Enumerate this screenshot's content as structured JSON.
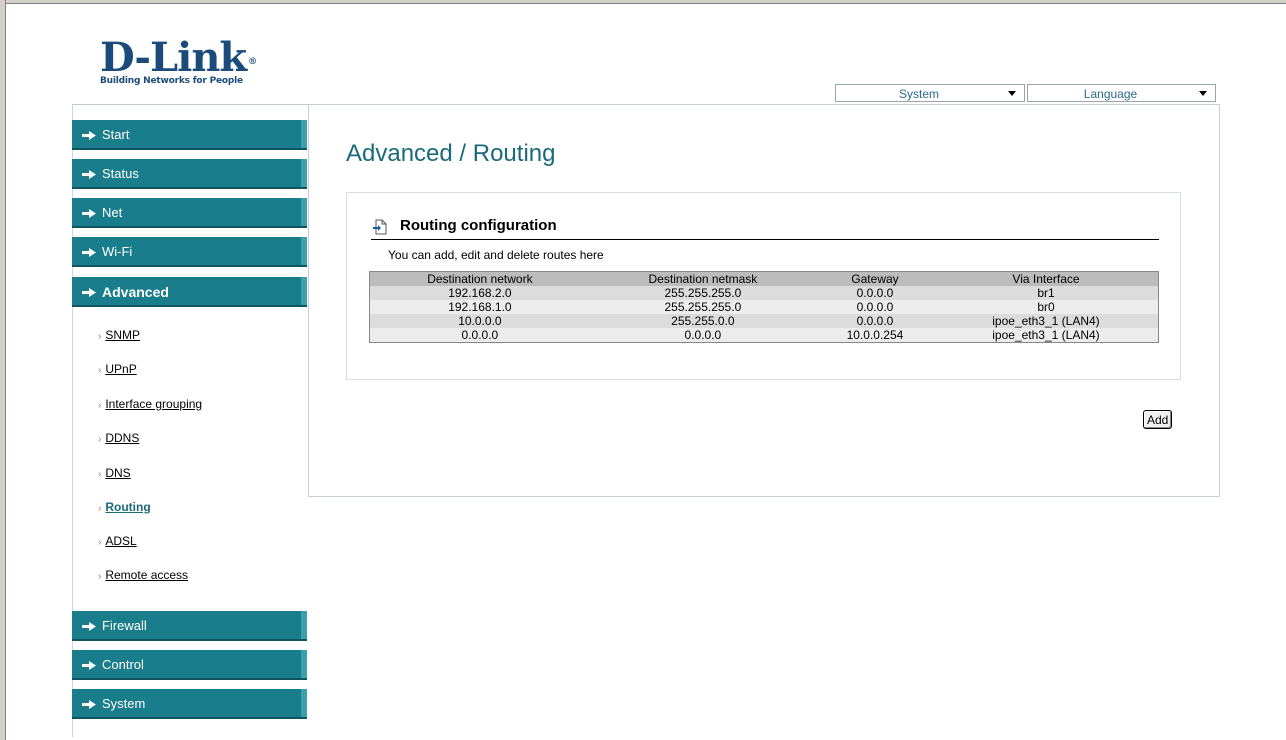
{
  "brand": {
    "logo_text": "D-Link",
    "tagline": "Building Networks for People"
  },
  "top_menus": {
    "system": "System",
    "language": "Language"
  },
  "sidebar": {
    "sections": [
      {
        "label": "Start"
      },
      {
        "label": "Status"
      },
      {
        "label": "Net"
      },
      {
        "label": "Wi-Fi"
      },
      {
        "label": "Advanced",
        "active": true
      },
      {
        "label": "Firewall"
      },
      {
        "label": "Control"
      },
      {
        "label": "System"
      }
    ],
    "sub_items": [
      {
        "label": "SNMP"
      },
      {
        "label": "UPnP"
      },
      {
        "label": "Interface grouping"
      },
      {
        "label": "DDNS"
      },
      {
        "label": "DNS"
      },
      {
        "label": "Routing",
        "current": true
      },
      {
        "label": "ADSL"
      },
      {
        "label": "Remote access"
      }
    ]
  },
  "page": {
    "title": "Advanced / Routing",
    "section_title": "Routing configuration",
    "section_desc": "You can add, edit and delete routes here",
    "table": {
      "headers": [
        "Destination network",
        "Destination netmask",
        "Gateway",
        "Via Interface"
      ],
      "rows": [
        [
          "192.168.2.0",
          "255.255.255.0",
          "0.0.0.0",
          "br1"
        ],
        [
          "192.168.1.0",
          "255.255.255.0",
          "0.0.0.0",
          "br0"
        ],
        [
          "10.0.0.0",
          "255.255.0.0",
          "0.0.0.0",
          "ipoe_eth3_1 (LAN4)"
        ],
        [
          "0.0.0.0",
          "0.0.0.0",
          "10.0.0.254",
          "ipoe_eth3_1 (LAN4)"
        ]
      ]
    },
    "add_button": "Add"
  },
  "colors": {
    "nav_bg": "#1a7d8c",
    "title": "#1a6b7a",
    "logo": "#1a4b7a"
  }
}
